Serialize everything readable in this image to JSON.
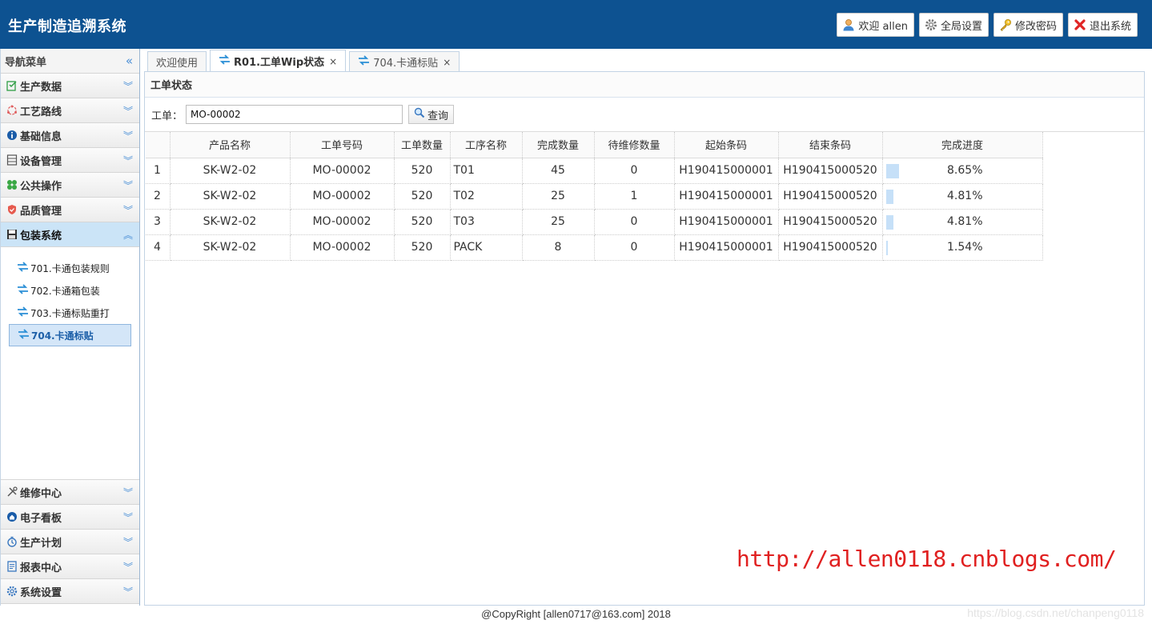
{
  "app": {
    "title": "生产制造追溯系统"
  },
  "header_buttons": [
    {
      "label": "欢迎 allen",
      "icon": "user-icon"
    },
    {
      "label": "全局设置",
      "icon": "gear-icon"
    },
    {
      "label": "修改密码",
      "icon": "key-icon"
    },
    {
      "label": "退出系统",
      "icon": "close-icon"
    }
  ],
  "sidebar": {
    "title": "导航菜单",
    "items_top": [
      {
        "label": "生产数据",
        "icon": "edit-icon"
      },
      {
        "label": "工艺路线",
        "icon": "route-icon"
      },
      {
        "label": "基础信息",
        "icon": "info-icon"
      },
      {
        "label": "设备管理",
        "icon": "equipment-icon"
      },
      {
        "label": "公共操作",
        "icon": "clover-icon"
      },
      {
        "label": "品质管理",
        "icon": "shield-icon"
      },
      {
        "label": "包装系统",
        "icon": "save-icon"
      }
    ],
    "sub_items": [
      {
        "label": "701.卡通包装规则"
      },
      {
        "label": "702.卡通箱包装"
      },
      {
        "label": "703.卡通标贴重打"
      },
      {
        "label": "704.卡通标贴"
      }
    ],
    "items_bottom": [
      {
        "label": "维修中心",
        "icon": "tools-icon"
      },
      {
        "label": "电子看板",
        "icon": "board-icon"
      },
      {
        "label": "生产计划",
        "icon": "timer-icon"
      },
      {
        "label": "报表中心",
        "icon": "report-icon"
      },
      {
        "label": "系统设置",
        "icon": "settings-icon"
      }
    ]
  },
  "tabs": [
    {
      "label": "欢迎使用"
    },
    {
      "label": "R01.工单Wip状态",
      "close": "×"
    },
    {
      "label": "704.卡通标贴",
      "close": "×"
    }
  ],
  "panel": {
    "title": "工单状态",
    "search_label": "工单：",
    "search_value": "MO-00002",
    "search_button": "查询"
  },
  "table": {
    "columns": [
      "",
      "产品名称",
      "工单号码",
      "工单数量",
      "工序名称",
      "完成数量",
      "待维修数量",
      "起始条码",
      "结束条码",
      "完成进度"
    ],
    "rows": [
      {
        "idx": "1",
        "product": "SK-W2-02",
        "order": "MO-00002",
        "qty": "520",
        "process": "T01",
        "done": "45",
        "repair": "0",
        "start": "H190415000001",
        "end": "H190415000520",
        "progress": "8.65%",
        "progress_value": 8.65
      },
      {
        "idx": "2",
        "product": "SK-W2-02",
        "order": "MO-00002",
        "qty": "520",
        "process": "T02",
        "done": "25",
        "repair": "1",
        "start": "H190415000001",
        "end": "H190415000520",
        "progress": "4.81%",
        "progress_value": 4.81
      },
      {
        "idx": "3",
        "product": "SK-W2-02",
        "order": "MO-00002",
        "qty": "520",
        "process": "T03",
        "done": "25",
        "repair": "0",
        "start": "H190415000001",
        "end": "H190415000520",
        "progress": "4.81%",
        "progress_value": 4.81
      },
      {
        "idx": "4",
        "product": "SK-W2-02",
        "order": "MO-00002",
        "qty": "520",
        "process": "PACK",
        "done": "8",
        "repair": "0",
        "start": "H190415000001",
        "end": "H190415000520",
        "progress": "1.54%",
        "progress_value": 1.54
      }
    ]
  },
  "watermark": "http://allen0118.cnblogs.com/",
  "footer": "@CopyRight [allen0717@163.com] 2018",
  "csdn": "https://blog.csdn.net/chanpeng0118",
  "colors": {
    "header_bg": "#0d5291",
    "active_menu": "#cbe4f7",
    "progress": "#c6e0f8",
    "watermark": "#e02020"
  }
}
